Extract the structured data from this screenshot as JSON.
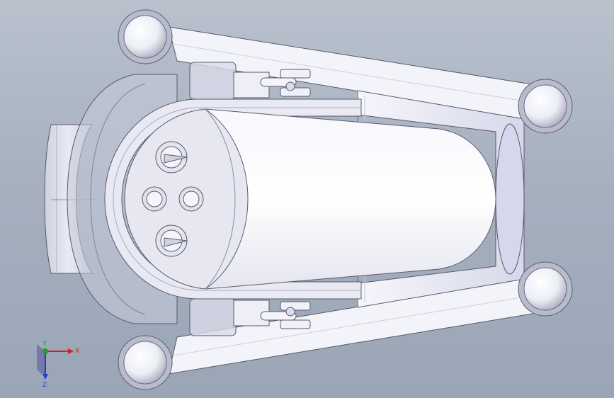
{
  "viewport": {
    "background_top": "#b9c1cd",
    "background_bottom": "#9aa5b6"
  },
  "triad": {
    "x_label": "X",
    "y_label": "Y",
    "z_label": "Z",
    "x_color": "#d42020",
    "y_color": "#20a020",
    "z_color": "#2040d0"
  },
  "model": {
    "name": "3d-assembly-model",
    "body_color": "#f4f4fb",
    "edge_color": "#5a5a6a",
    "shade_color": "#c9cad8"
  }
}
